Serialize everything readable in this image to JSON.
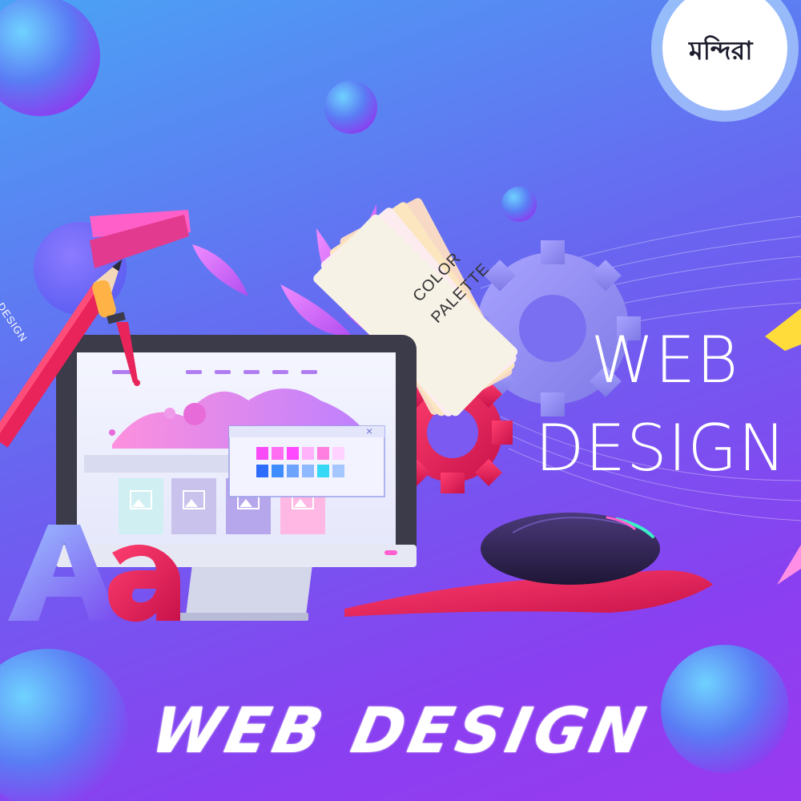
{
  "headline": {
    "line1": "WEB",
    "line2": "DESIGN"
  },
  "footer": {
    "title": "WEB DESIGN"
  },
  "pencil": {
    "label": "DESIGN"
  },
  "palette_card": {
    "line1": "COLOR",
    "line2": "PALETTE"
  },
  "typography": {
    "glyph_1": "A",
    "glyph_2": "a"
  },
  "browser_window": {
    "close_glyph": "×"
  },
  "brand": {
    "logo_text": "মন্দিরা"
  },
  "colors": {
    "bg_top": "#4aa3f5",
    "bg_bottom": "#9a3af0",
    "accent_red": "#e8245a",
    "accent_pink": "#ff5fd0",
    "gear_lavender": "#8f8cf0",
    "monitor_dark": "#3b3b4a",
    "screen": "#eef0fb"
  },
  "swatches": [
    "#f94af7",
    "#ff6df1",
    "#ff48ff",
    "#ffb2f9",
    "#ff7fe0",
    "#ffd2ff",
    "#2e6cff",
    "#3f8cff",
    "#6ba3ff",
    "#8eb8ff",
    "#35d9f5",
    "#a6c6ff"
  ],
  "palette_strips": [
    "#f7f2d6",
    "#ffe95a",
    "#ff9de0",
    "#6a8cff",
    "#d6ff5a",
    "#8d5bff"
  ]
}
